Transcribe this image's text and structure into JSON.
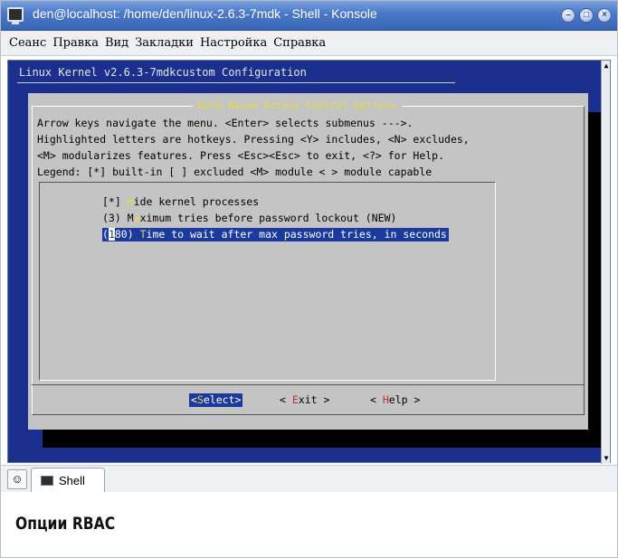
{
  "window": {
    "title": "den@localhost: /home/den/linux-2.6.3-7mdk - Shell - Konsole"
  },
  "menubar": {
    "items": [
      "Сеанс",
      "Правка",
      "Вид",
      "Закладки",
      "Настройка",
      "Справка"
    ]
  },
  "terminal": {
    "config_title": "Linux Kernel v2.6.3-7mdkcustom Configuration",
    "dialog": {
      "title": "Role Based Access Control Options",
      "help_lines": [
        "Arrow keys navigate the menu.  <Enter> selects submenus --->.",
        "Highlighted letters are hotkeys.  Pressing <Y> includes, <N> excludes,",
        "<M> modularizes features.  Press <Esc><Esc> to exit, <?> for Help.",
        "Legend: [*] built-in  [ ] excluded  <M> module  < > module capable"
      ],
      "options": [
        {
          "prefix": "[*] ",
          "hotkey": "H",
          "rest": "ide kernel processes",
          "selected": false
        },
        {
          "prefix": "(3) M",
          "hotkey": "a",
          "rest": "ximum tries before password lockout (NEW)",
          "selected": false
        },
        {
          "prefix_open": "(",
          "cursor": "1",
          "prefix_close": "80) ",
          "hotkey": "T",
          "rest": "ime to wait after max password tries, in seconds",
          "selected": true
        }
      ],
      "buttons": {
        "select": {
          "open": "<",
          "hotkey": "S",
          "rest": "elect",
          "close": ">"
        },
        "exit": {
          "open": "< ",
          "hotkey": "E",
          "rest": "xit",
          "close": " >"
        },
        "help": {
          "open": "< ",
          "hotkey": "H",
          "rest": "elp",
          "close": " >"
        }
      }
    }
  },
  "tabbar": {
    "tabs": [
      {
        "label": "Shell"
      }
    ]
  },
  "caption": "Опции RBAC",
  "colors": {
    "terminal_bg": "#1a2f8e",
    "dialog_bg": "#c4c4c4",
    "hotkey": "#e8d84a",
    "selection_bg": "#1a3a9e",
    "titlebar": "#4a78c8"
  }
}
